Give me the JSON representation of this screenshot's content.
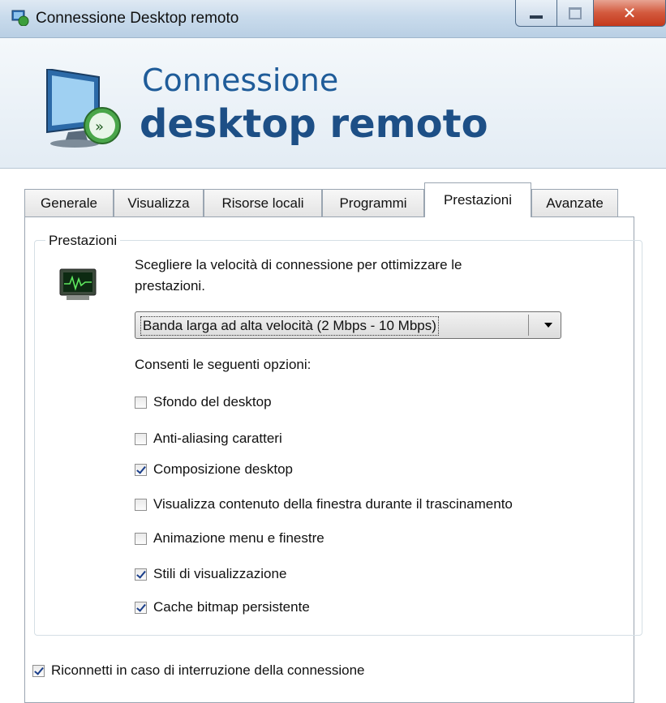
{
  "window": {
    "title": "Connessione Desktop remoto",
    "buttons": [
      "minimize",
      "maximize",
      "close"
    ]
  },
  "banner": {
    "line1": "Connessione",
    "line2": "desktop remoto",
    "icon": "remote-desktop-icon"
  },
  "tabs": [
    {
      "label": "Generale",
      "active": false
    },
    {
      "label": "Visualizza",
      "active": false
    },
    {
      "label": "Risorse locali",
      "active": false
    },
    {
      "label": "Programmi",
      "active": false
    },
    {
      "label": "Prestazioni",
      "active": true
    },
    {
      "label": "Avanzate",
      "active": false
    }
  ],
  "performance": {
    "group_label": "Prestazioni",
    "description_line1": "Scegliere la velocità di connessione per ottimizzare le",
    "description_line2": "prestazioni.",
    "speed_selected": "Banda larga ad alta velocità (2 Mbps - 10 Mbps)",
    "options_heading": "Consenti le seguenti opzioni:",
    "options": [
      {
        "label": "Sfondo del desktop",
        "checked": false
      },
      {
        "label": "Anti-aliasing caratteri",
        "checked": false
      },
      {
        "label": "Composizione desktop",
        "checked": true
      },
      {
        "label": "Visualizza contenuto della finestra durante il trascinamento",
        "checked": false
      },
      {
        "label": "Animazione menu e finestre",
        "checked": false
      },
      {
        "label": "Stili di visualizzazione",
        "checked": true
      },
      {
        "label": "Cache bitmap persistente",
        "checked": true
      }
    ]
  },
  "reconnect": {
    "label": "Riconnetti in caso di interruzione della connessione",
    "checked": true
  }
}
